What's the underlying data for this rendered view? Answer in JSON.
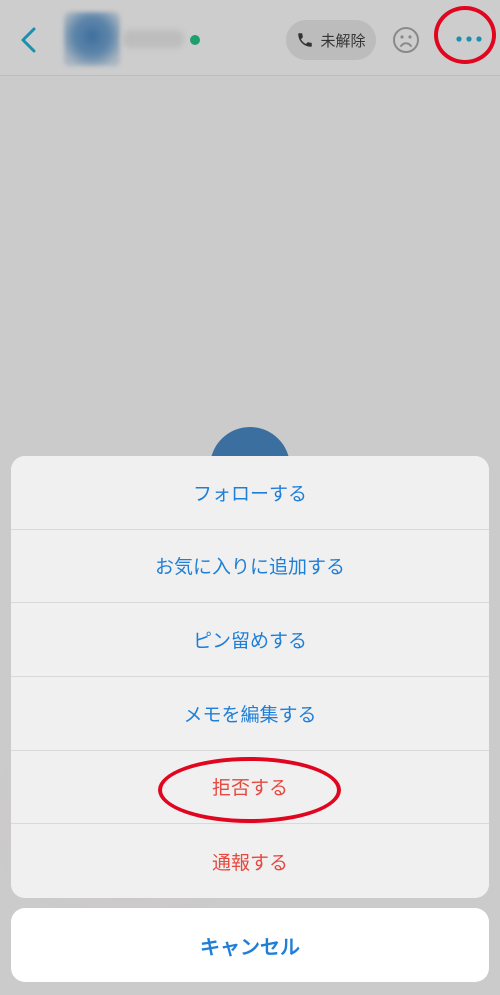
{
  "header": {
    "call_label": "未解除",
    "icons": {
      "back": "back-chevron-icon",
      "phone": "phone-icon",
      "mood": "sad-face-icon",
      "more": "more-dots-icon"
    },
    "accent_color": "#1f7fd6",
    "online_color": "#1f9e6e"
  },
  "action_sheet": {
    "items": [
      {
        "label": "フォローする"
      },
      {
        "label": "お気に入りに追加する"
      },
      {
        "label": "ピン留めする"
      },
      {
        "label": "メモを編集する"
      },
      {
        "label": "拒否する"
      },
      {
        "label": "通報する"
      }
    ],
    "cancel_label": "キャンセル",
    "danger_color": "#e5493f"
  }
}
